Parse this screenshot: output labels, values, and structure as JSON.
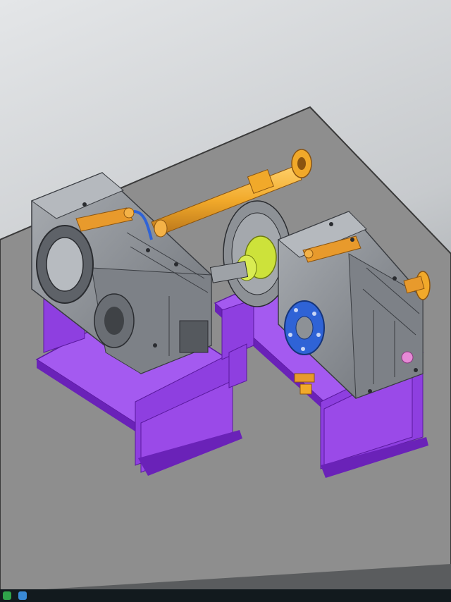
{
  "scene": {
    "description_visible_text": "",
    "colors": {
      "backdrop_light": "#dcdfe1",
      "backdrop_dark": "#9aa0a4",
      "floor": "#8e8e8e",
      "floor_edge": "#3a3a3a",
      "base_purple": "#8e3fe0",
      "base_purple_dark": "#6a22b8",
      "gearbox_gray": "#8d9196",
      "gearbox_dark": "#4a4d52",
      "shaft_orange": "#f1a92a",
      "coupling_green": "#cde23a",
      "flange_blue": "#2f63d6",
      "fitting_orange": "#e89a2c",
      "knob_pink": "#e68ad6",
      "taskbar": "#121a1e"
    },
    "icons": [
      "windows-start-icon",
      "app-icon"
    ]
  }
}
